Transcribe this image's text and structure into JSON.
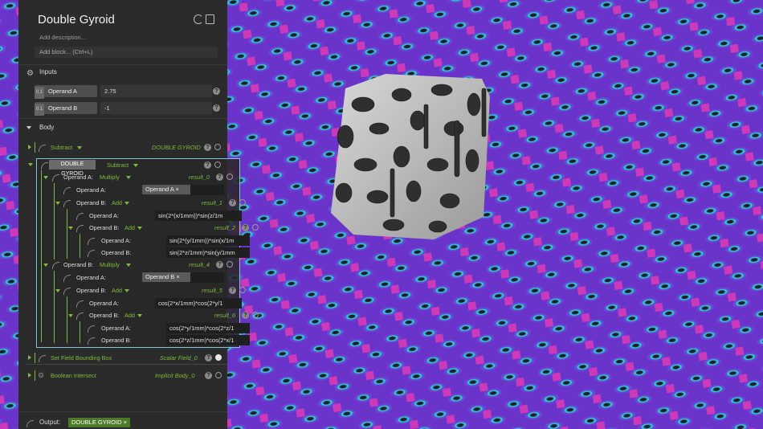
{
  "header": {
    "title": "Double Gyroid",
    "description_placeholder": "Add description...",
    "add_block_placeholder": "Add block... (Ctrl+L)"
  },
  "inputs": {
    "label": "Inputs",
    "items": [
      {
        "icon_text": "0.1",
        "label": "Operand A",
        "value": "2.75"
      },
      {
        "icon_text": "0.1",
        "label": "Operand B",
        "value": "-1"
      }
    ]
  },
  "body": {
    "label": "Body",
    "subtract_block": {
      "label": "Subtract",
      "output": "DOUBLE GYROID"
    },
    "double_gyroid": {
      "name": "DOUBLE GYROID",
      "op": "Subtract",
      "operand_a": {
        "label": "Operand A:",
        "op": "Multiply",
        "result": "result_0",
        "a_label": "Operand A:",
        "a_chip": "Operand A",
        "b_label": "Operand B:",
        "b_op": "Add",
        "b_result": "result_1",
        "b_a_label": "Operand A:",
        "b_a_value": "sin(2*(x/1mm))*sin(z/1m",
        "b_b_label": "Operand B:",
        "b_b_op": "Add",
        "b_b_result": "result_2",
        "b_b_a_label": "Operand A:",
        "b_b_a_value": "sin(2*(y/1mm))*sin(x/1m",
        "b_b_b_label": "Operand B:",
        "b_b_b_value": "sin(2*z/1mm)*sin(y/1mm"
      },
      "operand_b": {
        "label": "Operand B:",
        "op": "Multiply",
        "result": "result_4",
        "a_label": "Operand A:",
        "a_chip": "Operand B",
        "b_label": "Operand B:",
        "b_op": "Add",
        "b_result": "result_5",
        "b_a_label": "Operand A:",
        "b_a_value": "cos(2*x/1mm)*cos(2*y/1",
        "b_b_label": "Operand B:",
        "b_b_op": "Add",
        "b_b_result": "result_6",
        "b_b_a_label": "Operand A:",
        "b_b_a_value": "cos(2*y/1mm)*cos(2*z/1",
        "b_b_b_label": "Operand B:",
        "b_b_b_value": "cos(2*z/1mm)*cos(2*x/1"
      }
    },
    "set_field": {
      "label": "Set Field Bounding Box",
      "output": "Scalar Field_0"
    },
    "boolean": {
      "label": "Boolean Intersect",
      "output": "Implicit Body_0"
    }
  },
  "output": {
    "label": "Output:",
    "chip": "DOUBLE GYROID"
  },
  "icons": {
    "remove": "×",
    "help": "?",
    "chevron": "⌄"
  },
  "colors": {
    "accent_green": "#7dbb3c",
    "selection": "#7fc6d6",
    "panel_bg": "#2b2b2b"
  }
}
